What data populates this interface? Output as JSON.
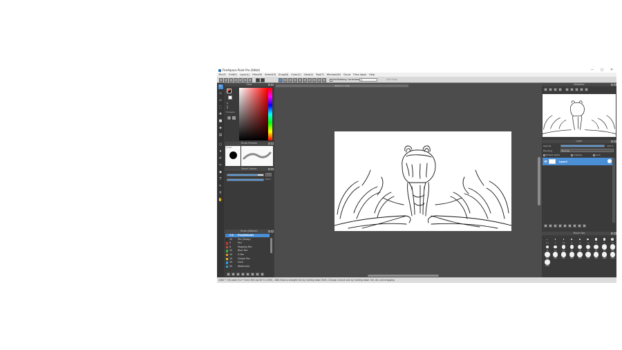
{
  "window": {
    "title": "FireAlpaca Paint Pro (64bit)",
    "buttons": [
      "—",
      "▢",
      "✕"
    ]
  },
  "menu": [
    "File(F)",
    "Edit(E)",
    "Layer(L)",
    "Filter(R)",
    "Select(S)",
    "Snap(N)",
    "Color(C)",
    "View(V)",
    "Tool(T)",
    "Window(W)",
    "Cloud",
    "Time-lapse",
    "Help"
  ],
  "toolbar": {
    "antialiasing_label": "AntiAliasing",
    "correction_label": "Correction",
    "correction_value": "0",
    "edge_label": "Soft Edge"
  },
  "panels": {
    "color": {
      "title": "Color",
      "primary_color": "#e34f3a",
      "secondary_color": "#000000",
      "mode_lines": [
        "R",
        "G",
        "B"
      ],
      "transparent_label": "Transpare"
    },
    "brush_preview": {
      "title": "Brush Preview",
      "size_label": "12.0px"
    },
    "brush_control": {
      "title": "Brush Control",
      "size_value": "1.0",
      "opacity_value": "100 %"
    },
    "brush": {
      "title": "Brush (Default)",
      "items": [
        {
          "size": "7.0",
          "name": "Pen(Default)",
          "color": "#3a7fd0",
          "selected": true
        },
        {
          "size": "10",
          "name": "Pen (Sharp)",
          "color": "#2d2d2d",
          "selected": false
        },
        {
          "size": "5",
          "name": "Pen",
          "color": "#c83232",
          "selected": false
        },
        {
          "size": "6",
          "name": "Mapping Pen",
          "color": "#d04a2a",
          "selected": false
        },
        {
          "size": "20",
          "name": "Blurr Pen",
          "color": "#3cb043",
          "selected": false
        },
        {
          "size": "10",
          "name": "G Pen",
          "color": "#e0a020",
          "selected": false
        },
        {
          "size": "10",
          "name": "Simple Pen",
          "color": "#e0c030",
          "selected": false
        },
        {
          "size": "20",
          "name": "Sumi",
          "color": "#2a9dd8",
          "selected": false
        },
        {
          "size": "50",
          "name": "Watercolor",
          "color": "#32a0d0",
          "selected": false
        }
      ]
    },
    "navigator": {
      "title": "Navigator"
    },
    "layer": {
      "title": "Layer",
      "opacity_label": "Opacity",
      "opacity_value": "100 %",
      "blending_label": "Blending",
      "blending_value": "Normal",
      "protect_label": "Protect Alpha",
      "clipping_label": "Clipping",
      "lock_label": "Lock",
      "layers": [
        {
          "name": "Layer1",
          "visible": true,
          "selected": true
        }
      ]
    },
    "brush_size": {
      "title": "Brush Size",
      "sizes": [
        "0.7",
        "1",
        "1.5",
        "2",
        "3",
        "4",
        "5",
        "7",
        "10",
        "12",
        "15",
        "20",
        "25",
        "30",
        "40",
        "50",
        "70",
        "100",
        "150",
        "200",
        "250",
        "300",
        "400",
        "500",
        "700",
        "1000",
        "1500",
        "2000"
      ]
    }
  },
  "document": {
    "tab_label": "Sketch_1.mdp"
  },
  "status": {
    "text": "1280 * 720 pixel  (5.4 * 3cm)  600 dpi  80 %  (1090, -188)  Draw a straight line by holding down Shift, Change a brush size by holding down Ctrl, Alt, and dragging"
  }
}
